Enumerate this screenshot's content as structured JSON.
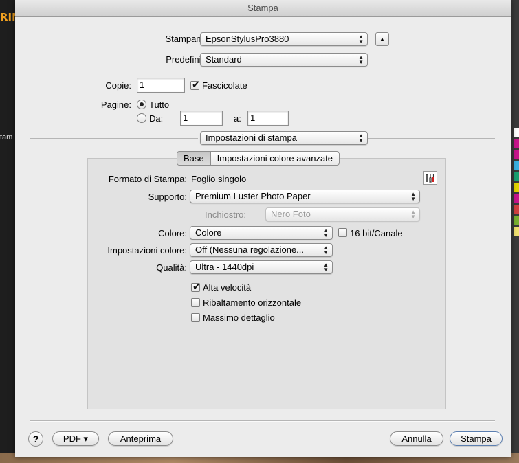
{
  "background": {
    "logo_text": "RIN",
    "side_text": "tam"
  },
  "window": {
    "title": "Stampa"
  },
  "printer": {
    "label": "Stampante:",
    "value": "EpsonStylusPro3880"
  },
  "presets": {
    "label": "Predefinite:",
    "value": "Standard"
  },
  "copies": {
    "label": "Copie:",
    "value": "1",
    "collate_label": "Fascicolate",
    "collate_checked": true
  },
  "pages": {
    "label": "Pagine:",
    "all_label": "Tutto",
    "from_label": "Da:",
    "from_value": "1",
    "to_label": "a:",
    "to_value": "1"
  },
  "section": {
    "value": "Impostazioni di stampa"
  },
  "tabs": [
    {
      "label": "Base"
    },
    {
      "label": "Impostazioni colore avanzate"
    }
  ],
  "settings": {
    "format_label": "Formato di Stampa:",
    "format_value": "Foglio singolo",
    "media_label": "Supporto:",
    "media_value": "Premium Luster Photo Paper",
    "ink_label": "Inchiostro:",
    "ink_value": "Nero Foto",
    "color_label": "Colore:",
    "color_value": "Colore",
    "bit_label": "16 bit/Canale",
    "color_settings_label": "Impostazioni colore:",
    "color_settings_value": "Off (Nessuna regolazione...",
    "quality_label": "Qualità:",
    "quality_value": "Ultra - 1440dpi",
    "high_speed_label": "Alta velocità",
    "flip_label": "Ribaltamento orizzontale",
    "max_detail_label": "Massimo dettaglio"
  },
  "footer": {
    "help": "?",
    "pdf": "PDF ▾",
    "preview": "Anteprima",
    "cancel": "Annulla",
    "print": "Stampa"
  },
  "colors": {
    "swatches": [
      "#ffffff",
      "#c8148c",
      "#c8148c",
      "#3ab0e0",
      "#1aa070",
      "#e2d400",
      "#c8148c",
      "#d04040",
      "#7ab030",
      "#f0e070"
    ]
  }
}
